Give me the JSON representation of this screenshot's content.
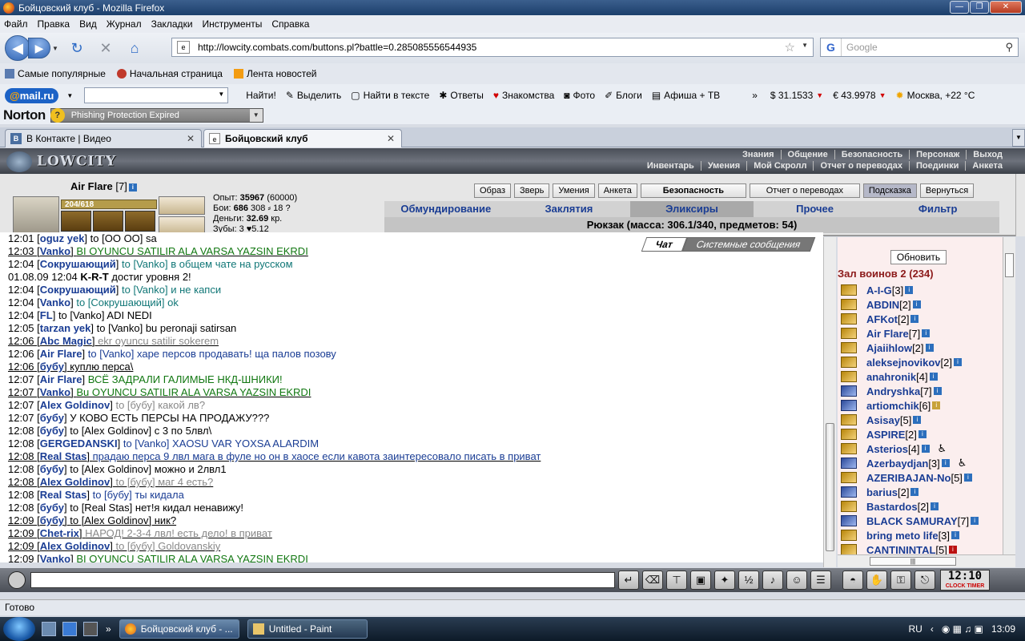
{
  "window": {
    "title": "Бойцовский клуб - Mozilla Firefox"
  },
  "menu": [
    "Файл",
    "Правка",
    "Вид",
    "Журнал",
    "Закладки",
    "Инструменты",
    "Справка"
  ],
  "nav": {
    "url": "http://lowcity.combats.com/buttons.pl?battle=0.285085556544935",
    "search_placeholder": "Google"
  },
  "bookmarks": [
    "Самые популярные",
    "Начальная страница",
    "Лента новостей"
  ],
  "mailru": {
    "logo_at": "@",
    "logo_mail": "mail",
    "logo_ru": ".ru",
    "find": "Найти!",
    "items": [
      "Выделить",
      "Найти в тексте",
      "Ответы",
      "Знакомства",
      "Фото",
      "Блоги",
      "Афиша + ТВ"
    ],
    "more": "»",
    "usd": "$ 31.1533",
    "eur": "€ 43.9978",
    "weather": "Москва, +22 °C"
  },
  "norton": {
    "logo": "Norton",
    "warning": "Phishing Protection Expired"
  },
  "tabs": [
    {
      "label": "В Контакте | Видео",
      "icon": "В"
    },
    {
      "label": "Бойцовский клуб",
      "icon": ""
    }
  ],
  "game": {
    "logo": "LOWCITY",
    "nav_row1": [
      "Знания",
      "Общение",
      "Безопасность",
      "Персонаж",
      "Выход"
    ],
    "nav_row2": [
      "Инвентарь",
      "Умения",
      "Мой Скролл",
      "Отчет о переводах",
      "Поединки",
      "Анкета"
    ]
  },
  "character": {
    "name": "Air Flare",
    "level": "[7]",
    "hp": "204/618",
    "stats": [
      {
        "label": "Опыт:",
        "value": "35967",
        "extra": "(60000)"
      },
      {
        "label": "Бои:",
        "value": "686",
        "extra": "308 ⸗  18 ?"
      },
      {
        "label": "Деньги:",
        "value": "32.69",
        "extra": "кр."
      },
      {
        "label": "Зубы:",
        "value": "",
        "extra": "3 ♥5.12"
      }
    ],
    "buttons": [
      "Образ",
      "Зверь",
      "Умения",
      "Анкета",
      "Безопасность",
      "Отчет о переводах",
      "Подсказка",
      "Вернуться"
    ],
    "inv_tabs": [
      "Обмундирование",
      "Заклятия",
      "Эликсиры",
      "Прочее",
      "Фильтр"
    ],
    "inv_summary": "Рюкзак (масса: 306.1/340, предметов: 54)"
  },
  "chat": {
    "tab_chat": "Чат",
    "tab_system": "Системные сообщения",
    "lines": [
      {
        "time": "12:01",
        "nick": "oguz yek",
        "text": "to [OO OO] sa",
        "color": "c-black",
        "private": false
      },
      {
        "time": "12:03",
        "nick": "Vanko",
        "text": "BI OYUNCU SATILIR ALA VARSA YAZSIN EKRDI",
        "color": "c-green",
        "private": true
      },
      {
        "time": "12:04",
        "nick": "Сокрушающий",
        "text": "to [Vanko] в общем чате на русском",
        "color": "c-teal",
        "private": false
      },
      {
        "time": "01.08.09 12:04",
        "nick": "K-R-T",
        "text": "достиг уровня 2!",
        "color": "c-black",
        "private": false,
        "system": true
      },
      {
        "time": "12:04",
        "nick": "Сокрушающий",
        "text": "to [Vanko] и не капси",
        "color": "c-teal",
        "private": false
      },
      {
        "time": "12:04",
        "nick": "Vanko",
        "text": "to [Сокрушающий] ok",
        "color": "c-teal",
        "private": false
      },
      {
        "time": "12:04",
        "nick": "FL",
        "text": "to [Vanko] ADI NEDI",
        "color": "c-black",
        "private": false
      },
      {
        "time": "12:05",
        "nick": "tarzan yek",
        "text": "to [Vanko] bu peronaji satirsan",
        "color": "c-black",
        "private": false
      },
      {
        "time": "12:06",
        "nick": "Abc Magic",
        "text": "ekr oyuncu satilir sokerem",
        "color": "c-grey",
        "private": true
      },
      {
        "time": "12:06",
        "nick": "Air Flare",
        "text": "to [Vanko] харе персов продавать! ща палов позову",
        "color": "c-blue",
        "private": false
      },
      {
        "time": "12:06",
        "nick": "бубу",
        "text": "куплю перса\\",
        "color": "c-black",
        "private": true
      },
      {
        "time": "12:07",
        "nick": "Air Flare",
        "text": "ВСЁ ЗАДРАЛИ ГАЛИМЫЕ НКД-ШНИКИ!",
        "color": "c-green",
        "private": false
      },
      {
        "time": "12:07",
        "nick": "Vanko",
        "text": "Bu OYUNCU SATILIR ALA VARSA YAZSIN EKRDI",
        "color": "c-green",
        "private": true
      },
      {
        "time": "12:07",
        "nick": "Alex Goldinov",
        "text": "to [бубу] какой лв?",
        "color": "c-grey",
        "private": false
      },
      {
        "time": "12:07",
        "nick": "бубу",
        "text": "У КОВО ЕСТЬ ПЕРСЫ НА ПРОДАЖУ???",
        "color": "c-black",
        "private": false
      },
      {
        "time": "12:08",
        "nick": "бубу",
        "text": "to [Alex Goldinov] с 3 по 5лвл\\",
        "color": "c-black",
        "private": false
      },
      {
        "time": "12:08",
        "nick": "GERGEDANSKI",
        "text": "to [Vanko] XAOSU VAR YOXSA ALARDIM",
        "color": "c-blue",
        "private": false
      },
      {
        "time": "12:08",
        "nick": "Real Stas",
        "text": "прадаю перса 9 лвл мага в фуле но он в хаосе если кавота заинтересовало писать в приват",
        "color": "c-blue",
        "private": true
      },
      {
        "time": "12:08",
        "nick": "бубу",
        "text": "to [Alex Goldinov] можно и 2лвл1",
        "color": "c-black",
        "private": false
      },
      {
        "time": "12:08",
        "nick": "Alex Goldinov",
        "text": "to [бубу] маг 4 есть?",
        "color": "c-grey",
        "private": true
      },
      {
        "time": "12:08",
        "nick": "Real Stas",
        "text": "to [бубу] ты кидала",
        "color": "c-blue",
        "private": false
      },
      {
        "time": "12:08",
        "nick": "бубу",
        "text": "to [Real Stas] нет!я кидал ненавижу!",
        "color": "c-black",
        "private": false
      },
      {
        "time": "12:09",
        "nick": "бубу",
        "text": "to [Alex Goldinov] ник?",
        "color": "c-black",
        "private": true
      },
      {
        "time": "12:09",
        "nick": "Chet-rix",
        "text": "НАРОД! 2-3-4 лвл! есть дело! в приват",
        "color": "c-grey",
        "private": true
      },
      {
        "time": "12:09",
        "nick": "Alex Goldinov",
        "text": "to [бубу] Goldovanskiy",
        "color": "c-grey",
        "private": true
      },
      {
        "time": "12:09",
        "nick": "Vanko",
        "text": "BI OYUNCU SATILIR ALA VARSA YAZSIN EKRDI",
        "color": "c-green",
        "private": true
      }
    ]
  },
  "room": {
    "refresh": "Обновить",
    "title": "Зал воинов 2 (234)",
    "players": [
      {
        "name": "A-I-G",
        "level": "[3]",
        "align": "gold",
        "info": "blue"
      },
      {
        "name": "ABDIN",
        "level": "[2]",
        "align": "gold",
        "info": "blue"
      },
      {
        "name": "AFKot",
        "level": "[2]",
        "align": "gold",
        "info": "blue"
      },
      {
        "name": "Air Flare",
        "level": "[7]",
        "align": "gold",
        "info": "blue"
      },
      {
        "name": "Ajaiihlow",
        "level": "[2]",
        "align": "gold",
        "info": "blue"
      },
      {
        "name": "aleksejnovikov",
        "level": "[2]",
        "align": "gold",
        "info": "blue"
      },
      {
        "name": "anahronik",
        "level": "[4]",
        "align": "gold",
        "info": "blue"
      },
      {
        "name": "Andryshka",
        "level": "[7]",
        "align": "blue",
        "info": "blue"
      },
      {
        "name": "artiomchik",
        "level": "[6]",
        "align": "blue",
        "info": "gold"
      },
      {
        "name": "Asisay",
        "level": "[5]",
        "align": "gold",
        "info": "blue"
      },
      {
        "name": "ASPIRE",
        "level": "[2]",
        "align": "gold",
        "info": "blue"
      },
      {
        "name": "Asterios",
        "level": "[4]",
        "align": "gold",
        "info": "blue",
        "extra": "♿"
      },
      {
        "name": "Azerbaydjan",
        "level": "[3]",
        "align": "blue",
        "info": "blue",
        "extra": "♿"
      },
      {
        "name": "AZERIBAJAN-No",
        "level": "[5]",
        "align": "gold",
        "info": "blue"
      },
      {
        "name": "barius",
        "level": "[2]",
        "align": "blue",
        "info": "blue"
      },
      {
        "name": "Bastardos",
        "level": "[2]",
        "align": "gold",
        "info": "blue"
      },
      {
        "name": "BLACK SAMURAY",
        "level": "[7]",
        "align": "blue",
        "info": "blue"
      },
      {
        "name": "bring meto life",
        "level": "[3]",
        "align": "gold",
        "info": "blue"
      },
      {
        "name": "CANTININTAL",
        "level": "[5]",
        "align": "gold",
        "info": "red"
      }
    ]
  },
  "inputbar": {
    "clock": "12:10",
    "clock_label": "CLOCK TIMER"
  },
  "status": "Готово",
  "taskbar": {
    "tasks": [
      "Бойцовский клуб - ...",
      "Untitled - Paint"
    ],
    "lang": "RU",
    "time": "13:09"
  }
}
